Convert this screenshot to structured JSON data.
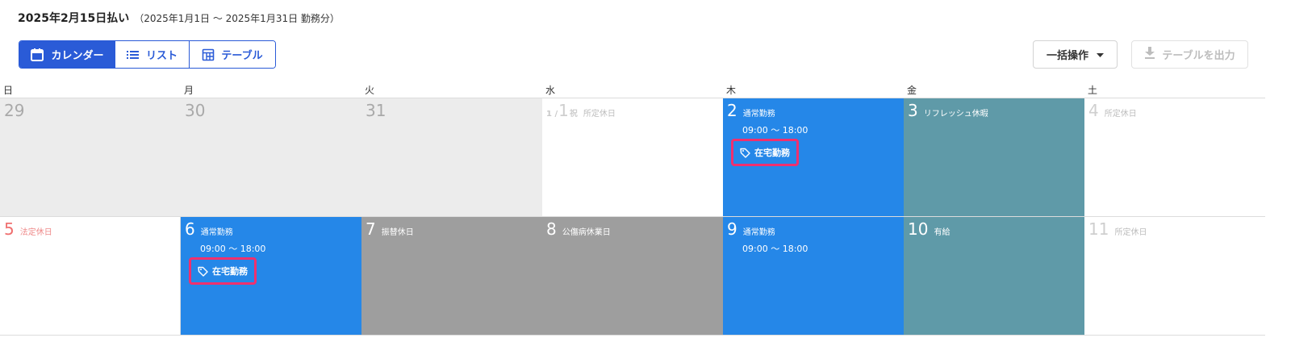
{
  "header": {
    "title": "2025年2月15日払い",
    "subtitle": "（2025年1月1日 ～ 2025年1月31日 勤務分）"
  },
  "views": {
    "calendar": "カレンダー",
    "list": "リスト",
    "table": "テーブル",
    "active": "calendar"
  },
  "actions": {
    "bulk": "一括操作",
    "export": "テーブルを出力"
  },
  "weekdays": [
    "日",
    "月",
    "火",
    "水",
    "木",
    "金",
    "土"
  ],
  "weeks": [
    [
      {
        "num": "29"
      },
      {
        "num": "30"
      },
      {
        "num": "31"
      },
      {
        "prefix": "1 /",
        "num": "1",
        "holiday": "祝",
        "label": "所定休日"
      },
      {
        "num": "2",
        "label": "通常勤務",
        "time": "09:00 ～ 18:00",
        "tag": "在宅勤務"
      },
      {
        "num": "3",
        "label": "リフレッシュ休暇"
      },
      {
        "num": "4",
        "label": "所定休日"
      }
    ],
    [
      {
        "num": "5",
        "label": "法定休日"
      },
      {
        "num": "6",
        "label": "通常勤務",
        "time": "09:00 ～ 18:00",
        "tag": "在宅勤務"
      },
      {
        "num": "7",
        "label": "振替休日"
      },
      {
        "num": "8",
        "label": "公傷病休業日"
      },
      {
        "num": "9",
        "label": "通常勤務",
        "time": "09:00 ～ 18:00"
      },
      {
        "num": "10",
        "label": "有給"
      },
      {
        "num": "11",
        "label": "所定休日"
      }
    ]
  ],
  "colors": {
    "primary": "#2a5bd7",
    "work": "#2587e8",
    "leave": "#5f9aa8",
    "absence": "#9e9e9e",
    "highlight": "#f0306e",
    "legal_holiday": "#ef6f6f"
  }
}
